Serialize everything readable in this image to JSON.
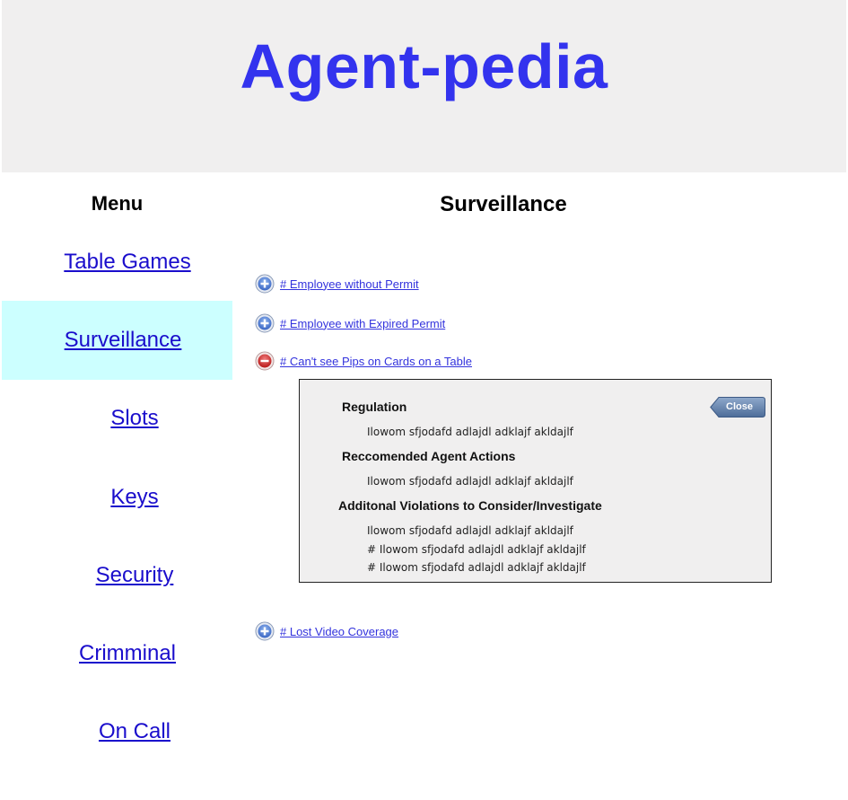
{
  "header": {
    "title": "Agent-pedia"
  },
  "sidebar": {
    "heading": "Menu",
    "items": [
      {
        "label": "Table Games",
        "active": false
      },
      {
        "label": "Surveillance",
        "active": true
      },
      {
        "label": "Slots",
        "active": false
      },
      {
        "label": "Keys",
        "active": false
      },
      {
        "label": "Security",
        "active": false
      },
      {
        "label": "Crimminal",
        "active": false
      },
      {
        "label": "On Call",
        "active": false
      }
    ]
  },
  "main": {
    "title": "Surveillance",
    "items": [
      {
        "label": "# Employee without Permit",
        "icon": "plus-circle-icon",
        "expanded": false
      },
      {
        "label": "# Employee with Expired Permit",
        "icon": "plus-circle-icon",
        "expanded": false
      },
      {
        "label": "# Can't see Pips on Cards on a Table",
        "icon": "minus-circle-icon",
        "expanded": true
      },
      {
        "label": "# Lost Video Coverage",
        "icon": "plus-circle-icon",
        "expanded": false
      }
    ],
    "panel": {
      "close_label": "Close",
      "regulation_heading": "Regulation",
      "regulation_text": "Ilowom sfjodafd adlajdl adklajf  akldajlf",
      "actions_heading": "Reccomended Agent Actions",
      "actions_text": "Ilowom sfjodafd adlajdl adklajf  akldajlf",
      "violations_heading": "Additonal Violations to Consider/Investigate",
      "violations_text": [
        "Ilowom sfjodafd adlajdl adklajf  akldajlf",
        "# Ilowom sfjodafd adlajdl adklajf  akldajlf",
        "# Ilowom sfjodafd adlajdl adklajf  akldajlf"
      ]
    }
  },
  "colors": {
    "title_blue": "#3333ee",
    "link_blue": "#1a0dcc",
    "active_bg": "#ccffff",
    "header_bg": "#f0efef",
    "close_button": "#5f7ca6",
    "minus_red": "#cc2222"
  }
}
